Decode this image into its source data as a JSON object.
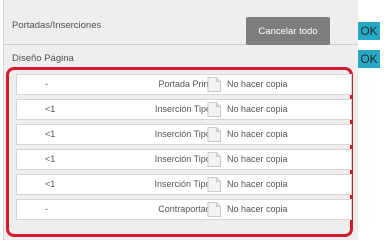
{
  "header": {
    "section1_label": "Portadas/Inserciones",
    "cancel_label": "Cancelar todo",
    "ok1_label": "OK",
    "section2_label": "Diseño Página",
    "ok2_label": "OK"
  },
  "rows": [
    {
      "num": "-",
      "type": "Portada Princ.",
      "copy": "No hacer copia",
      "icon": "page-icon"
    },
    {
      "num": "<1",
      "type": "Inserción Tipo A",
      "copy": "No hacer copia",
      "icon": "page-icon"
    },
    {
      "num": "<1",
      "type": "Inserción Tipo B",
      "copy": "No hacer copia",
      "icon": "page-icon"
    },
    {
      "num": "<1",
      "type": "Inserción Tipo B",
      "copy": "No hacer copia",
      "icon": "page-icon"
    },
    {
      "num": "<1",
      "type": "Inserción Tipo C",
      "copy": "No hacer copia",
      "icon": "page-icon"
    },
    {
      "num": "-",
      "type": "Contraportada",
      "copy": "No hacer copia",
      "icon": "page-icon"
    }
  ],
  "colors": {
    "ok_button": "#25a9c4",
    "cancel_button": "#7d7d7d",
    "highlight_box": "#d9182d"
  }
}
